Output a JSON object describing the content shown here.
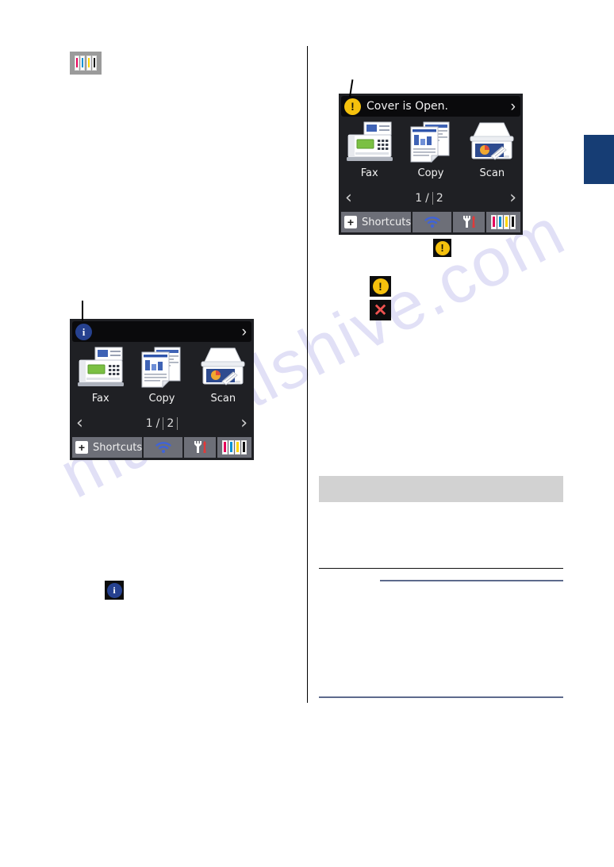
{
  "page": {
    "watermark_text": "manualshive.com",
    "side_tab_color": "#163d74",
    "divider_color": "#000000",
    "gray_box_color": "#d2d2d2",
    "blue_rule_color": "#5d6a8c"
  },
  "standalone_icons": {
    "ink_chip": {
      "name": "ink-levels-icon",
      "background": "#9b9b9b",
      "cartridges": [
        "#e5005a",
        "#0091d5",
        "#ffd500",
        "#111111"
      ]
    },
    "warning_large": {
      "name": "warning-icon",
      "glyph": "!",
      "circle_color": "#f5c10d",
      "background": "#0d0d0d"
    },
    "warning_small": {
      "name": "warning-icon",
      "glyph": "!",
      "circle_color": "#f5c10d",
      "background": "#0d0d0d"
    },
    "error_x": {
      "name": "error-cross-icon",
      "glyph": "✕",
      "color": "#ef5350",
      "background": "#0d0d0d"
    },
    "info_small": {
      "name": "information-icon",
      "glyph": "i",
      "circle_color": "#26418f",
      "background": "#0d0d0d"
    }
  },
  "lcd_left": {
    "name": "home-screen-information",
    "status_bar": {
      "badge": "information-icon",
      "badge_glyph": "i",
      "badge_color": "#26418f",
      "message": "",
      "chevron": "›"
    },
    "apps": [
      {
        "label": "Fax",
        "icon": "fax-machine-icon"
      },
      {
        "label": "Copy",
        "icon": "copy-documents-icon"
      },
      {
        "label": "Scan",
        "icon": "scanner-icon"
      }
    ],
    "pager": {
      "prev": "‹",
      "next": "›",
      "current": "1",
      "separator": "/",
      "total": "2"
    },
    "taskbar": {
      "shortcuts_label": "Shortcuts",
      "shortcuts_plus": "+",
      "wifi_icon": "wifi-icon",
      "settings_icon": "settings-tools-icon",
      "ink_icon": "ink-levels-icon",
      "ink_colors": [
        "#e5005a",
        "#0091d5",
        "#ffd500",
        "#111111"
      ]
    }
  },
  "lcd_right": {
    "name": "home-screen-error",
    "status_bar": {
      "badge": "warning-icon",
      "badge_glyph": "!",
      "badge_color": "#f5c10d",
      "message": "Cover is Open.",
      "chevron": "›"
    },
    "apps": [
      {
        "label": "Fax",
        "icon": "fax-machine-icon"
      },
      {
        "label": "Copy",
        "icon": "copy-documents-icon"
      },
      {
        "label": "Scan",
        "icon": "scanner-icon"
      }
    ],
    "pager": {
      "prev": "‹",
      "next": "›",
      "current": "1",
      "separator": "/",
      "total": "2"
    },
    "taskbar": {
      "shortcuts_label": "Shortcuts",
      "shortcuts_plus": "+",
      "wifi_icon": "wifi-icon",
      "settings_icon": "settings-tools-icon",
      "ink_icon": "ink-levels-icon",
      "ink_colors": [
        "#e5005a",
        "#0091d5",
        "#ffd500",
        "#111111"
      ]
    }
  }
}
